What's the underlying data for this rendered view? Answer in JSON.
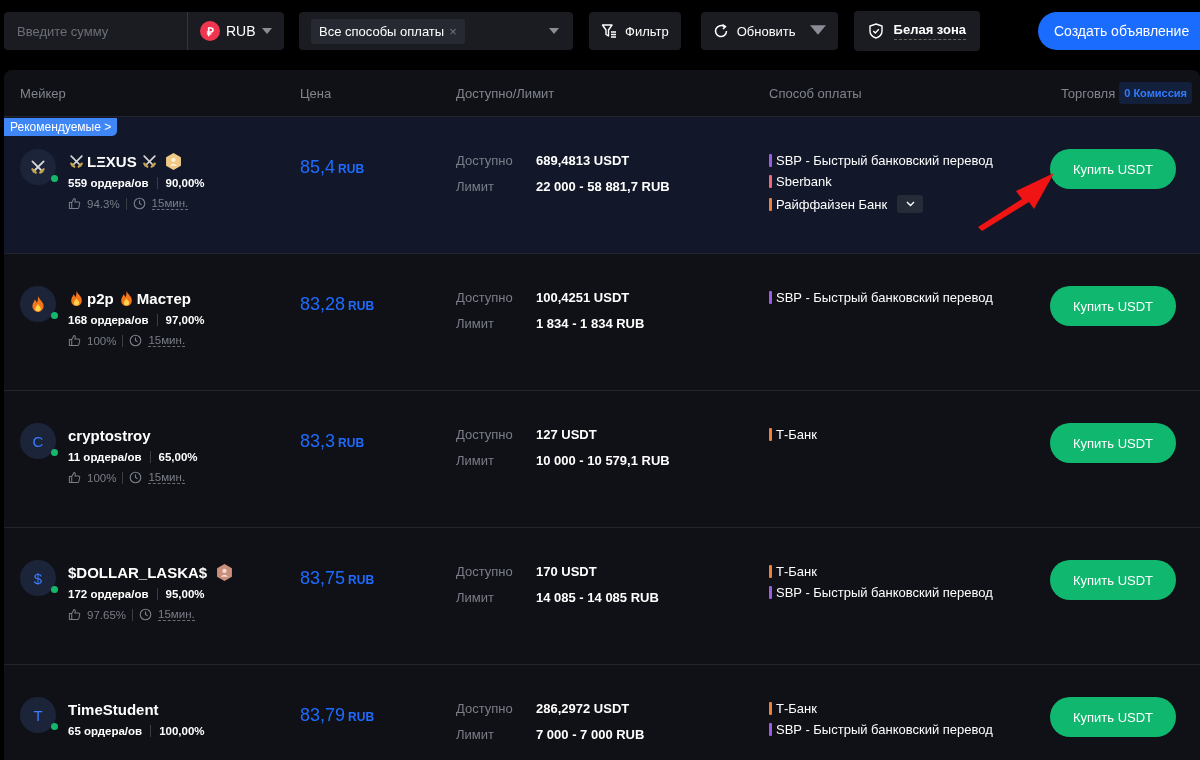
{
  "toolbar": {
    "amount_field": {
      "placeholder": "Введите сумму"
    },
    "currency": {
      "symbol": "₽",
      "code": "RUB"
    },
    "payment_filter": {
      "tag": "Все способы оплаты",
      "remove": "×"
    },
    "filter_button": "Фильтр",
    "refresh_button": "Обновить",
    "white_zone": "Белая зона",
    "create_button": "Создать объявление"
  },
  "table": {
    "columns": [
      "Мейкер",
      "Цена",
      "Доступно/Лимит",
      "Способ оплаты",
      "Торговля"
    ],
    "commission_badge": "0 Комиссия",
    "offers": [
      {
        "recommended": "Рекомендуемые >",
        "avatar": {
          "kind": "swords"
        },
        "online": true,
        "name": [
          {
            "kind": "swords"
          },
          {
            "kind": "text",
            "text": "LΞXUS"
          },
          {
            "kind": "swords"
          }
        ],
        "badge": {
          "kind": "gold"
        },
        "orders": "559 ордера/ов",
        "completion": "90,00%",
        "rating": "94.3%",
        "time": "15мин.",
        "price": "85,4",
        "currency": "RUB",
        "available_label": "Доступно",
        "available": "689,4813 USDT",
        "limit_label": "Лимит",
        "limit": "22 000 - 58 881,7 RUB",
        "payments": [
          {
            "name": "SBP - Быстрый банковский перевод",
            "color": "#9b5de5"
          },
          {
            "name": "Sberbank",
            "color": "#f2667a"
          },
          {
            "name": "Райффайзен Банк",
            "color": "#f07f3c"
          }
        ],
        "more_payments": true,
        "button": "Купить USDT",
        "arrow": true
      },
      {
        "avatar": {
          "kind": "flame"
        },
        "online": true,
        "name": [
          {
            "kind": "flame"
          },
          {
            "kind": "text",
            "text": "p2p"
          },
          {
            "kind": "flame"
          },
          {
            "kind": "text",
            "text": "Мастер"
          }
        ],
        "orders": "168 ордера/ов",
        "completion": "97,00%",
        "rating": "100%",
        "time": "15мин.",
        "price": "83,28",
        "currency": "RUB",
        "available_label": "Доступно",
        "available": "100,4251 USDT",
        "limit_label": "Лимит",
        "limit": "1 834 - 1 834 RUB",
        "payments": [
          {
            "name": "SBP - Быстрый банковский перевод",
            "color": "#9b5de5"
          }
        ],
        "more_payments": false,
        "button": "Купить USDT",
        "arrow": false
      },
      {
        "avatar": {
          "kind": "letter",
          "text": "C"
        },
        "online": true,
        "name": [
          {
            "kind": "text",
            "text": "cryptostroy"
          }
        ],
        "orders": "11 ордера/ов",
        "completion": "65,00%",
        "rating": "100%",
        "time": "15мин.",
        "price": "83,3",
        "currency": "RUB",
        "available_label": "Доступно",
        "available": "127 USDT",
        "limit_label": "Лимит",
        "limit": "10 000 - 10 579,1 RUB",
        "payments": [
          {
            "name": "Т-Банк",
            "color": "#f07f3c"
          }
        ],
        "more_payments": false,
        "button": "Купить USDT",
        "arrow": false
      },
      {
        "avatar": {
          "kind": "letter",
          "text": "$"
        },
        "online": true,
        "name": [
          {
            "kind": "text",
            "text": "$DOLLAR_LASKA$"
          }
        ],
        "badge": {
          "kind": "bronze"
        },
        "orders": "172 ордера/ов",
        "completion": "95,00%",
        "rating": "97.65%",
        "time": "15мин.",
        "price": "83,75",
        "currency": "RUB",
        "available_label": "Доступно",
        "available": "170 USDT",
        "limit_label": "Лимит",
        "limit": "14 085 - 14 085 RUB",
        "payments": [
          {
            "name": "Т-Банк",
            "color": "#f07f3c"
          },
          {
            "name": "SBP - Быстрый банковский перевод",
            "color": "#9b5de5"
          }
        ],
        "more_payments": false,
        "button": "Купить USDT",
        "arrow": false
      },
      {
        "avatar": {
          "kind": "letter",
          "text": "T"
        },
        "online": true,
        "name": [
          {
            "kind": "text",
            "text": "TimeStudent"
          }
        ],
        "orders": "65 ордера/ов",
        "completion": "100,00%",
        "price": "83,79",
        "currency": "RUB",
        "available_label": "Доступно",
        "available": "286,2972 USDT",
        "limit_label": "Лимит",
        "limit": "7 000 - 7 000 RUB",
        "payments": [
          {
            "name": "Т-Банк",
            "color": "#f07f3c"
          },
          {
            "name": "SBP - Быстрый банковский перевод",
            "color": "#9b5de5"
          }
        ],
        "more_payments": false,
        "button": "Купить USDT",
        "arrow": false
      }
    ]
  }
}
